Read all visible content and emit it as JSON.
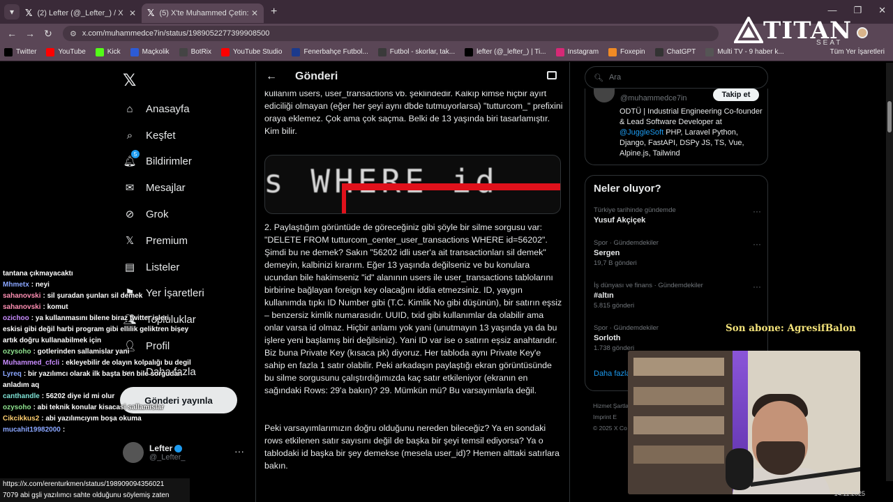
{
  "browser": {
    "tabs": [
      {
        "title": "(2) Lefter (@_Lefter_) / X",
        "active": false
      },
      {
        "title": "(5) X'te Muhammed Çetin: \"@F",
        "active": true
      }
    ],
    "url": "x.com/muhammedce7in/status/1989052277399908500",
    "bookmarks": [
      {
        "label": "Twitter",
        "icon": "x-icon",
        "color": "#000000"
      },
      {
        "label": "YouTube",
        "icon": "youtube-icon",
        "color": "#ff0000"
      },
      {
        "label": "Kick",
        "icon": "kick-icon",
        "color": "#53fc18"
      },
      {
        "label": "Maçkolik",
        "icon": "mackolik-icon",
        "color": "#2d5bd6"
      },
      {
        "label": "BotRix",
        "icon": "botrix-icon",
        "color": "#444444"
      },
      {
        "label": "YouTube Studio",
        "icon": "youtube-studio-icon",
        "color": "#ff0000"
      },
      {
        "label": "Fenerbahçe Futbol...",
        "icon": "fenerbahce-icon",
        "color": "#1b3a8c"
      },
      {
        "label": "Futbol - skorlar, tak...",
        "icon": "football-icon",
        "color": "#3a3a3a"
      },
      {
        "label": "lefter (@_lefter_) | Ti...",
        "icon": "tiktok-icon",
        "color": "#000000"
      },
      {
        "label": "Instagram",
        "icon": "instagram-icon",
        "color": "#d62976"
      },
      {
        "label": "Foxepin",
        "icon": "fox-icon",
        "color": "#f08a24"
      },
      {
        "label": "ChatGPT",
        "icon": "chatgpt-icon",
        "color": "#333333"
      },
      {
        "label": "Multi TV - 9 haber k...",
        "icon": "multitv-icon",
        "color": "#555555"
      }
    ],
    "all_bookmarks": "Tüm Yer İşaretleri"
  },
  "overlay_logo": {
    "word": "TITAN",
    "sub": "SEAT"
  },
  "nav": {
    "items": [
      {
        "label": "Anasayfa",
        "icon": "home-icon"
      },
      {
        "label": "Keşfet",
        "icon": "search-icon"
      },
      {
        "label": "Bildirimler",
        "icon": "bell-icon",
        "badge": "5"
      },
      {
        "label": "Mesajlar",
        "icon": "mail-icon"
      },
      {
        "label": "Grok",
        "icon": "grok-icon"
      },
      {
        "label": "Premium",
        "icon": "x-premium-icon"
      },
      {
        "label": "Listeler",
        "icon": "list-icon"
      },
      {
        "label": "Yer İşaretleri",
        "icon": "bookmark-icon"
      },
      {
        "label": "Topluluklar",
        "icon": "communities-icon"
      },
      {
        "label": "Profil",
        "icon": "profile-icon"
      },
      {
        "label": "Daha fazla",
        "icon": "more-icon"
      }
    ],
    "post_button": "Gönderi yayınla",
    "profile": {
      "name": "Lefter",
      "handle": "@_Lefter_"
    }
  },
  "post": {
    "header": "Gönderi",
    "paragraph_top": "kullanım users, user_transactions vb. şeklindedir. Kalkıp kimse hiçbir ayırt ediciliği olmayan (eğer her şeyi aynı dbde tutmuyorlarsa) \"tutturcom_\" prefixini oraya eklemez. Çok ama çok saçma. Belki de 13 yaşında biri tasarlamıştır. Kim bilir.",
    "image_text": "s WHERE id",
    "paragraph_2": "2. Paylaştığım görüntüde de göreceğiniz gibi şöyle bir silme sorgusu var: \"DELETE FROM tutturcom_center_user_transactions WHERE id=56202\". Şimdi bu ne demek? Sakın \"56202 idli user'a ait transactionları sil demek\" demeyin, kalbinizi kırarım. Eğer 13 yaşında değilseniz ve bu konulara ucundan bile hakimseniz \"id\" alanının users ile user_transactions tablolarını birbirine bağlayan foreign key olacağını iddia etmezsiniz. ID, yaygın kullanımda tıpkı ID Number gibi (T.C. Kimlik No gibi düşünün), bir satırın eşsiz – benzersiz kimlik numarasıdır. UUID, txid gibi kullanımlar da olabilir ama onlar varsa id olmaz. Hiçbir anlamı yok yani (unutmayın 13 yaşında ya da bu işlere yeni başlamış biri değilsiniz). Yani ID var ise o satırın eşsiz anahtarıdır. Biz buna Private Key (kısaca pk) diyoruz. Her tabloda aynı Private Key'e sahip en fazla 1 satır olabilir. Peki arkadaşın paylaştığı ekran görüntüsünde bu silme sorgusunu çalıştırdığımızda kaç satır etkileniyor (ekranın en sağındaki Rows: 29'a bakın)? 29. Mümkün mü? Bu varsayımlarla değil.",
    "paragraph_3": "Peki varsayımlarımızın doğru olduğunu nereden bileceğiz? Ya en sondaki rows etkilenen satır sayısını değil de başka bir şeyi temsil ediyorsa? Ya o tablodaki id başka bir şey demekse (mesela user_id)? Hemen alttaki satırlara bakın."
  },
  "sidebar": {
    "search_placeholder": "Ara",
    "profile_card": {
      "handle": "@muhammedce7in",
      "follow": "Takip et",
      "bio_1": "ODTÜ | Industrial Engineering Co-founder & Lead Software Developer at ",
      "mention": "@JuggleSoft",
      "bio_2": " PHP, Laravel Python, Django, FastAPI, DSPy JS, TS, Vue, Alpine.js, Tailwind"
    },
    "trends_title": "Neler oluyor?",
    "trends": [
      {
        "category": "Türkiye tarihinde gündemde",
        "name": "Yusuf Akçiçek",
        "count": ""
      },
      {
        "category": "Spor · Gündemdekiler",
        "name": "Sergen",
        "count": "19,7 B gönderi"
      },
      {
        "category": "İş dünyası ve finans · Gündemdekiler",
        "name": "#altın",
        "count": "5.815 gönderi"
      },
      {
        "category": "Spor · Gündemdekiler",
        "name": "Sorloth",
        "count": "1.738 gönderi"
      }
    ],
    "show_more": "Daha fazla",
    "footer_1": "Hizmet Şartları",
    "footer_2": "Imprint   E",
    "footer_3": "© 2025 X Co"
  },
  "stream": {
    "sub_alert": "Son abone: AgresifBalon",
    "chat": [
      {
        "user": "",
        "text": "tantana çıkmayacaktı",
        "color": "u-blue"
      },
      {
        "user": "Mhmetx",
        "text": ": neyi",
        "color": "u-blue"
      },
      {
        "user": "sahanovski",
        "text": ": sil şuradan şunları sil demek",
        "color": "u-pink"
      },
      {
        "user": "sahanovski",
        "text": ": komut",
        "color": "u-pink"
      },
      {
        "user": "ozichoo",
        "text": ": ya kullanmasını bilene biraz twitter işleri, eskisi gibi değil harbi program gibi ellilik geliktren bişey artık doğru kullanabilmek için",
        "color": "u-violet"
      },
      {
        "user": "ozysoho",
        "text": ": gotlerinden sallamislar yani",
        "color": "u-green"
      },
      {
        "user": "Muhammed_cfcli",
        "text": ": ekleyebilir de olayın kolpalığı bu degil",
        "color": "u-violet"
      },
      {
        "user": "Lyreq",
        "text": ": bir yazılımcı olarak ilk başta ben bile sorgudan anladım aq",
        "color": "u-blue"
      },
      {
        "user": "canthandle",
        "text": ": 56202 diye id mi olur",
        "color": "u-teal"
      },
      {
        "user": "ozysoho",
        "text": ": abi teknik konular kisacasi sallamislar",
        "color": "u-green"
      },
      {
        "user": "Cikcikkus2",
        "text": ": abi yazılımcıyım boşa okuma",
        "color": "u-orange"
      },
      {
        "user": "mucahit19982000",
        "text": ":",
        "color": "u-blue"
      }
    ],
    "status_url": "https://x.com/erenturkmen/status/198909094356021",
    "status_text": "7079 abi gşli yazılımcı sahte olduğunu söylemiş zaten",
    "clock": "14.11.2025"
  }
}
